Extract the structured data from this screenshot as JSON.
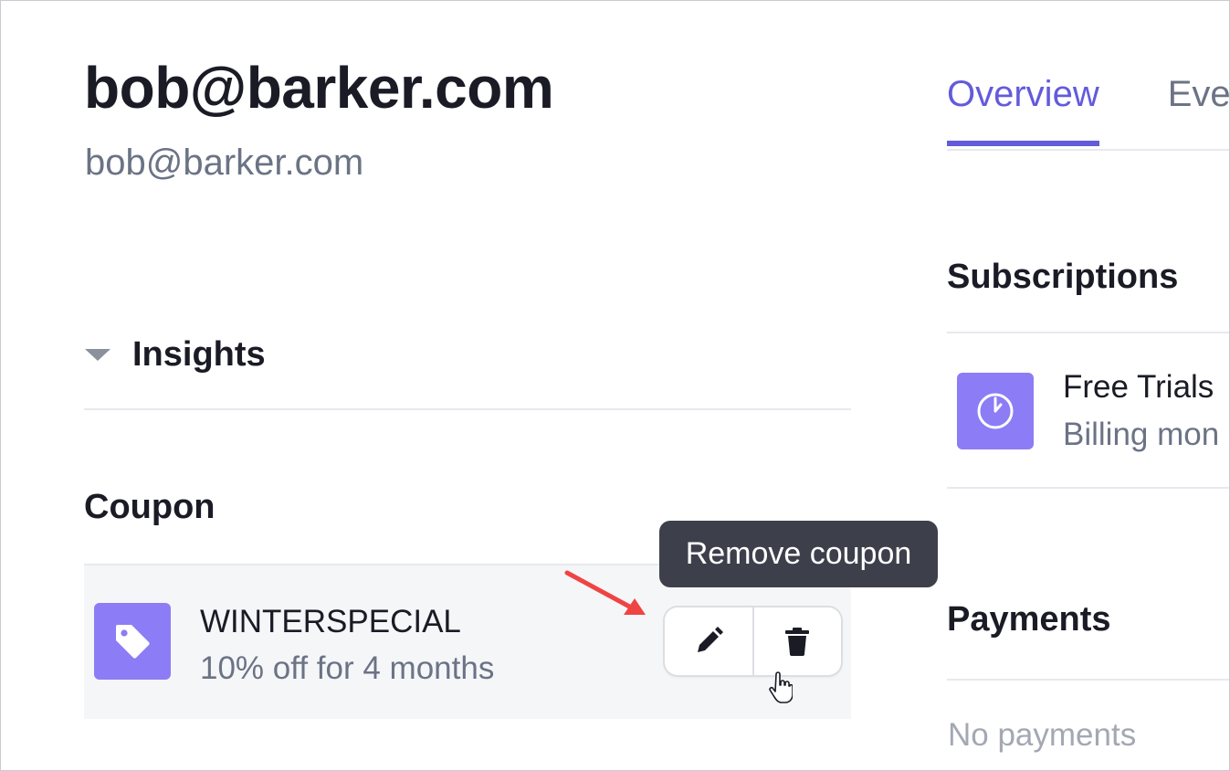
{
  "customer": {
    "name": "bob@barker.com",
    "email": "bob@barker.com"
  },
  "insights": {
    "label": "Insights"
  },
  "coupon": {
    "title": "Coupon",
    "code": "WINTERSPECIAL",
    "description": "10% off for 4 months",
    "edit_icon": "pencil-icon",
    "remove_icon": "trash-icon",
    "tooltip": "Remove coupon"
  },
  "tabs": [
    {
      "label": "Overview",
      "active": true
    },
    {
      "label": "Eve",
      "active": false
    }
  ],
  "subscriptions": {
    "title": "Subscriptions",
    "items": [
      {
        "name": "Free Trials",
        "detail": "Billing mon",
        "icon": "clock-icon"
      }
    ]
  },
  "payments": {
    "title": "Payments",
    "empty_text": "No payments"
  },
  "colors": {
    "accent": "#635bdb",
    "tile": "#8c7cf5",
    "tooltip_bg": "#3d404b",
    "annotation_arrow": "#ef4444"
  }
}
